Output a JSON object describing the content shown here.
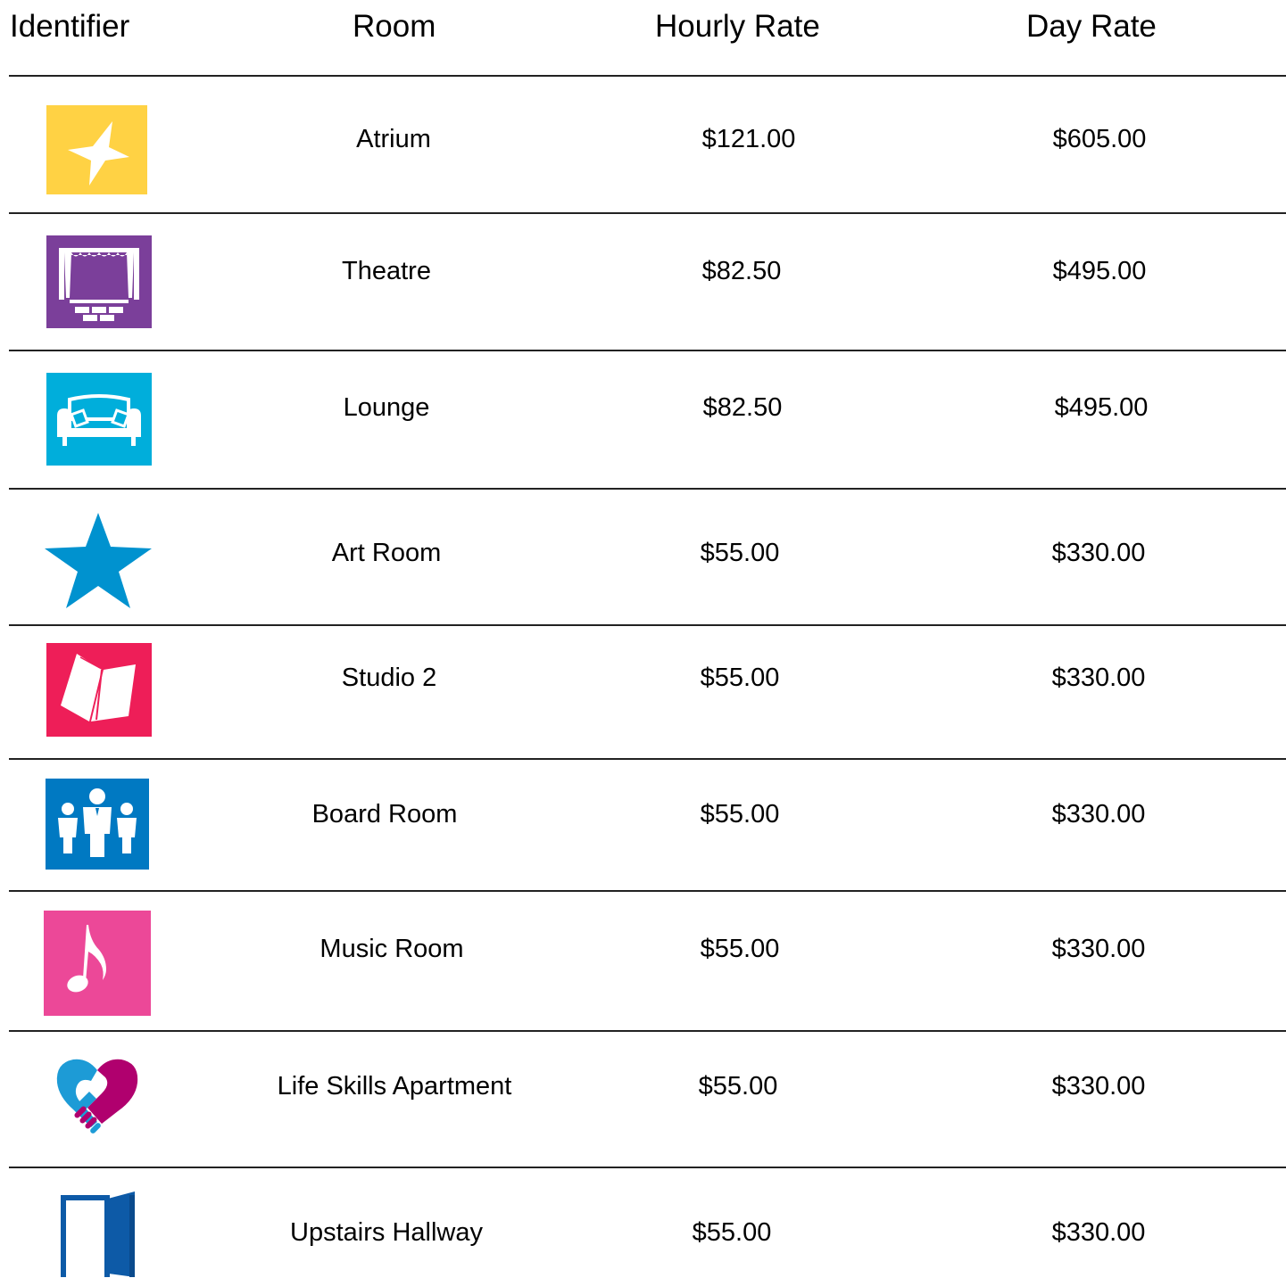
{
  "table": {
    "headers": {
      "identifier": "Identifier",
      "room": "Room",
      "hourly": "Hourly Rate",
      "day": "Day Rate"
    },
    "rows": [
      {
        "icon": "star-icon",
        "color": "#FFD244",
        "room": "Atrium",
        "hourly": "$121.00",
        "day": "$605.00"
      },
      {
        "icon": "theatre-stage-icon",
        "color": "#7B3F9A",
        "room": "Theatre",
        "hourly": "$82.50",
        "day": "$495.00"
      },
      {
        "icon": "sofa-icon",
        "color": "#00AEDB",
        "room": "Lounge",
        "hourly": "$82.50",
        "day": "$495.00"
      },
      {
        "icon": "star-icon",
        "color": "#0092CF",
        "room": "Art Room",
        "hourly": "$55.00",
        "day": "$330.00"
      },
      {
        "icon": "open-book-icon",
        "color": "#EE1E58",
        "room": "Studio 2",
        "hourly": "$55.00",
        "day": "$330.00"
      },
      {
        "icon": "people-group-icon",
        "color": "#0079C2",
        "room": "Board Room",
        "hourly": "$55.00",
        "day": "$330.00"
      },
      {
        "icon": "music-note-icon",
        "color": "#EC4898",
        "room": "Music Room",
        "hourly": "$55.00",
        "day": "$330.00"
      },
      {
        "icon": "heart-handshake-icon",
        "color": "#B0006E",
        "room": "Life Skills Apartment",
        "hourly": "$55.00",
        "day": "$330.00"
      },
      {
        "icon": "open-door-icon",
        "color": "#0D5AA7",
        "room": "Upstairs Hallway",
        "hourly": "$55.00",
        "day": "$330.00"
      }
    ]
  }
}
